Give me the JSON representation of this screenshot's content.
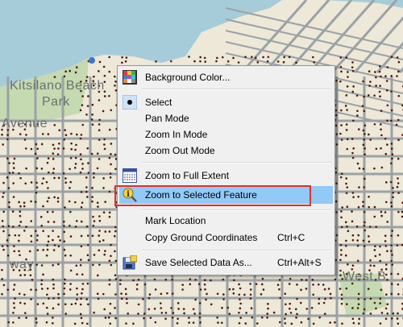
{
  "map": {
    "labels": {
      "park_line1": "Kitsilano Beach",
      "park_line2": "Park",
      "avenue": "Avenue",
      "way": "way",
      "west": "West B"
    },
    "colors": {
      "water": "#a7ccd9",
      "land": "#ede8d8",
      "road": "#9aa2a6",
      "dot": "#4a1b0c",
      "park": "#c5dab0"
    }
  },
  "context_menu": {
    "items": [
      {
        "label": "Background Color...",
        "shortcut": "",
        "icon": "color-grid-icon"
      },
      {
        "label": "Select",
        "shortcut": "",
        "icon": "selected-bullet-icon"
      },
      {
        "label": "Pan Mode",
        "shortcut": ""
      },
      {
        "label": "Zoom In Mode",
        "shortcut": ""
      },
      {
        "label": "Zoom Out Mode",
        "shortcut": ""
      },
      {
        "label": "Zoom to Full Extent",
        "shortcut": "",
        "icon": "full-extent-icon"
      },
      {
        "label": "Zoom to Selected Feature",
        "shortcut": "",
        "icon": "info-magnifier-icon",
        "highlighted": true
      },
      {
        "label": "Mark Location",
        "shortcut": ""
      },
      {
        "label": "Copy Ground Coordinates",
        "shortcut": "Ctrl+C"
      },
      {
        "label": "Save Selected Data As...",
        "shortcut": "Ctrl+Alt+S",
        "icon": "save-data-icon"
      }
    ]
  }
}
